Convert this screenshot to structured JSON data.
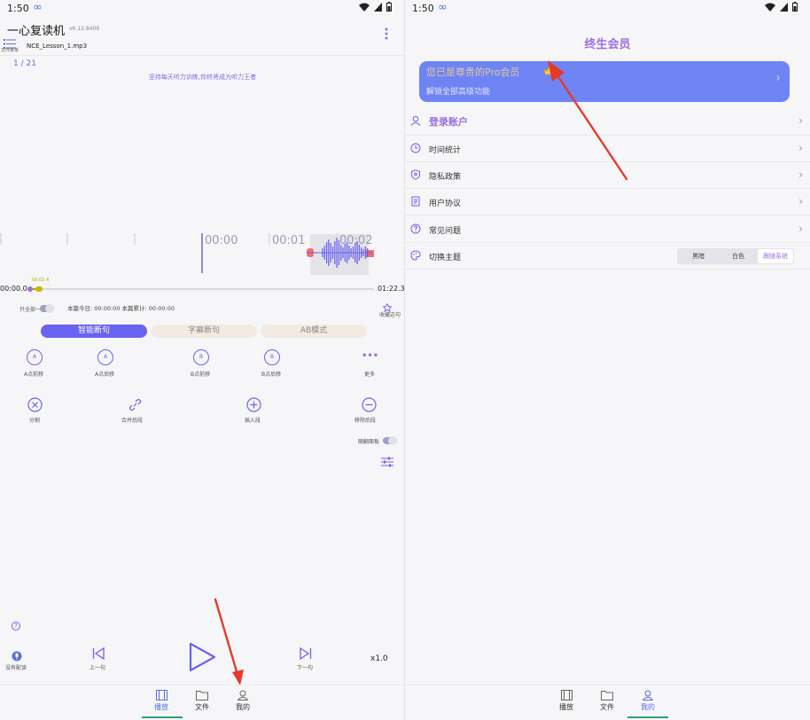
{
  "left": {
    "status_time": "1:50",
    "status_inf": "∞",
    "app_title": "一心复读机",
    "version": "v6.12.8409",
    "file_list_label": "文件菜单",
    "file_name": "NCE_Lesson_1.mp3",
    "page_indicator": "1 / 21",
    "motto": "坚持每天听力训练,你终将成为听力王者",
    "timeline_labels": [
      "00:00",
      "00:01",
      "00:02"
    ],
    "progress_start": "00:00.0",
    "progress_marker": "00:02.4",
    "progress_end": "01:22.3",
    "progress_fraction": 0.03,
    "loop_label": "只全部一遍",
    "today_stats": "本篇今日: 00:00:00 本篇累计: 00:00:00",
    "favorite_label": "收藏这句",
    "modes": [
      "智能断句",
      "字幕断句",
      "AB模式"
    ],
    "ab_tools": [
      {
        "icon": "A",
        "label": "A点前移"
      },
      {
        "icon": "A",
        "label": "A点后移"
      },
      {
        "icon": "B",
        "label": "B点前移"
      },
      {
        "icon": "B",
        "label": "B点后移"
      },
      {
        "icon": "•••",
        "label": "更多"
      }
    ],
    "edit_tools": [
      {
        "label": "分割"
      },
      {
        "label": "合并后段"
      },
      {
        "label": "插入段"
      },
      {
        "label": "移除后段"
      }
    ],
    "follow_label": "随翻面板",
    "help_icon": "?",
    "record_label": "没有配读",
    "prev_label": "上一句",
    "next_label": "下一句",
    "speed": "x1.0",
    "nav": [
      "播放",
      "文件",
      "我的"
    ]
  },
  "right": {
    "status_time": "1:50",
    "status_inf": "∞",
    "page_title": "终生会员",
    "pro_title": "您已是尊贵的Pro会员",
    "pro_subtitle": "解锁全部高级功能",
    "login_label": "登录账户",
    "menu": [
      "时间统计",
      "隐私政策",
      "用户协议",
      "常见问题",
      "切换主题"
    ],
    "themes": [
      "黑暗",
      "白色",
      "跟随系统"
    ],
    "selected_theme": "跟随系统",
    "nav": [
      "播放",
      "文件",
      "我的"
    ]
  },
  "colors": {
    "accent": "#6a62f0",
    "pro_banner": "#6f84f4",
    "annotation_arrow": "#e53a2a",
    "waveform": "#6a62f0",
    "clip_marker": "#ee7070"
  }
}
